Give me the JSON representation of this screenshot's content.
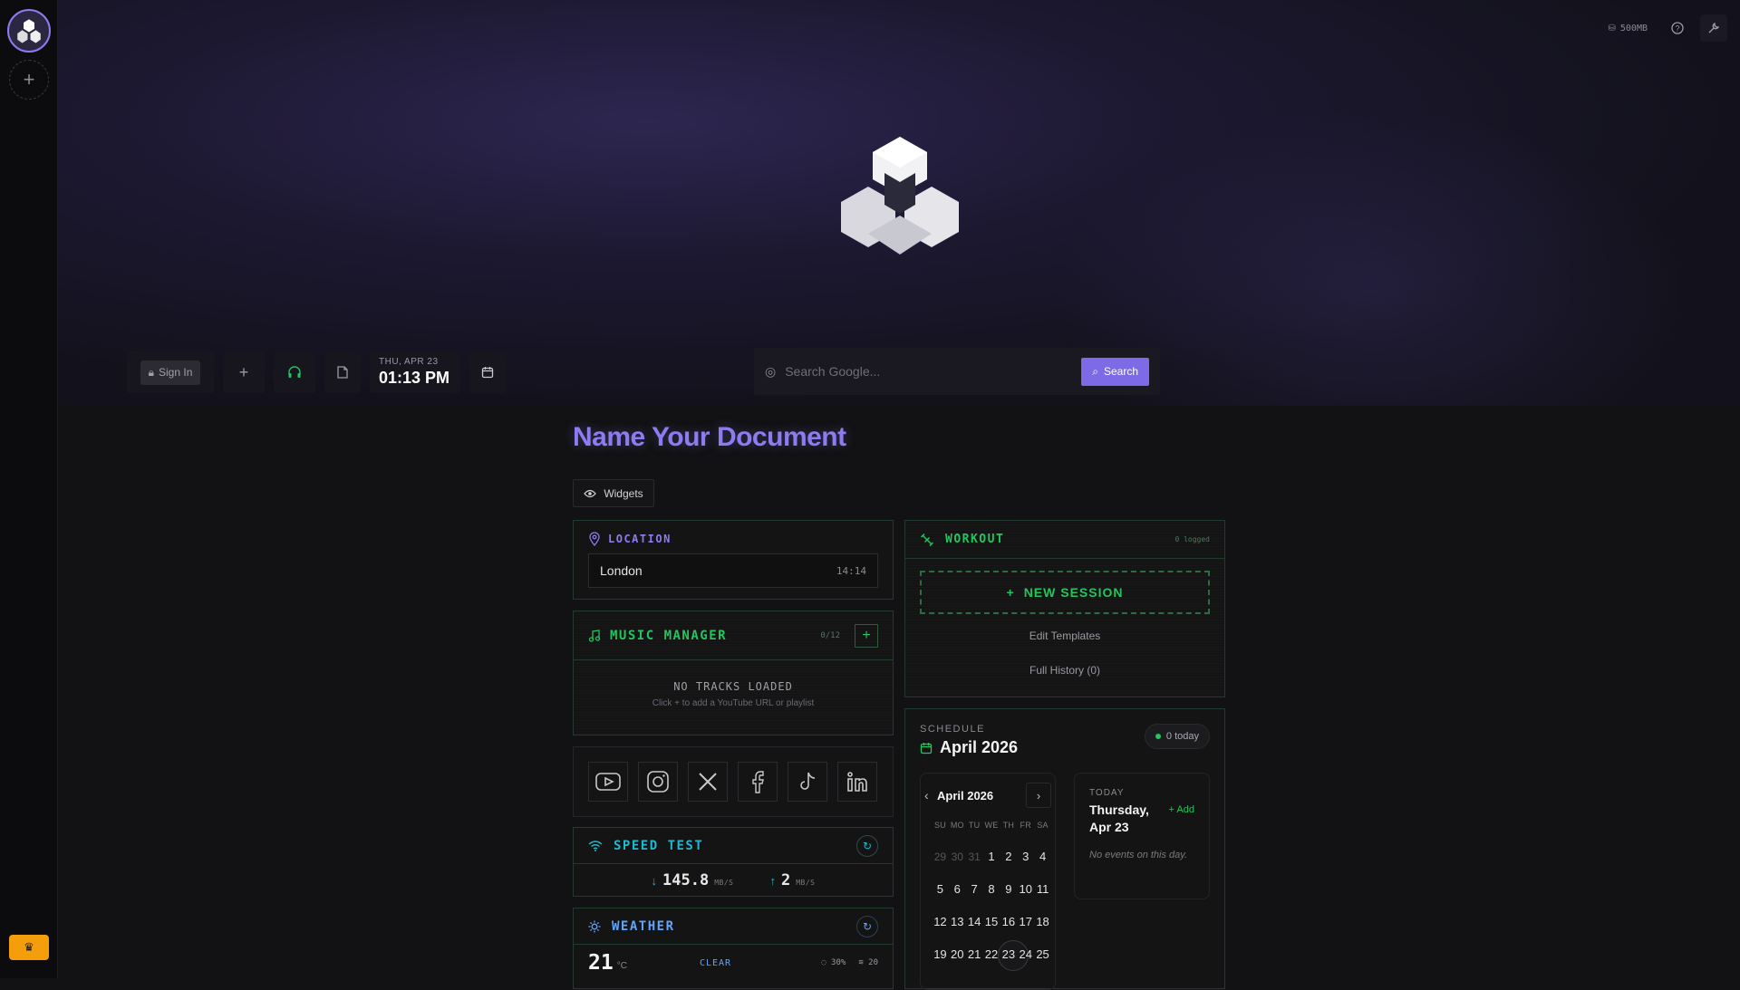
{
  "topbar": {
    "storage": "500MB",
    "help_icon": "help-icon",
    "settings_icon": "wrench-icon"
  },
  "toolbar": {
    "sign_in": "Sign In",
    "date": "THU, APR 23",
    "time": "01:13 PM"
  },
  "search": {
    "placeholder": "Search Google...",
    "button": "Search"
  },
  "document": {
    "title": "Name Your Document",
    "widgets_label": "Widgets"
  },
  "location": {
    "title": "LOCATION",
    "city": "London",
    "time": "14:14"
  },
  "music": {
    "title": "MUSIC MANAGER",
    "count": "0/12",
    "empty_title": "NO TRACKS LOADED",
    "empty_hint": "Click + to add a YouTube URL or playlist"
  },
  "social": [
    "youtube-icon",
    "instagram-icon",
    "x-icon",
    "facebook-icon",
    "tiktok-icon",
    "linkedin-icon"
  ],
  "speed": {
    "title": "SPEED TEST",
    "download": "145.8",
    "upload": "2",
    "unit": "MB/S"
  },
  "weather": {
    "title": "WEATHER",
    "temp": "21",
    "unit": "°C",
    "condition": "CLEAR",
    "humidity": "30%",
    "wind": "20"
  },
  "workout": {
    "title": "WORKOUT",
    "logged": "0 logged",
    "new_session": "NEW SESSION",
    "edit_templates": "Edit Templates",
    "history": "Full History (0)"
  },
  "schedule": {
    "label": "SCHEDULE",
    "month": "April 2026",
    "badge": "0 today",
    "calendar_month": "April 2026",
    "weekdays": [
      "SU",
      "MO",
      "TU",
      "WE",
      "TH",
      "FR",
      "SA"
    ],
    "days": [
      {
        "d": "29",
        "muted": true
      },
      {
        "d": "30",
        "muted": true
      },
      {
        "d": "31",
        "muted": true
      },
      {
        "d": "1"
      },
      {
        "d": "2"
      },
      {
        "d": "3"
      },
      {
        "d": "4"
      },
      {
        "d": "5"
      },
      {
        "d": "6"
      },
      {
        "d": "7"
      },
      {
        "d": "8"
      },
      {
        "d": "9"
      },
      {
        "d": "10"
      },
      {
        "d": "11"
      },
      {
        "d": "12"
      },
      {
        "d": "13"
      },
      {
        "d": "14"
      },
      {
        "d": "15"
      },
      {
        "d": "16"
      },
      {
        "d": "17"
      },
      {
        "d": "18"
      },
      {
        "d": "19"
      },
      {
        "d": "20"
      },
      {
        "d": "21"
      },
      {
        "d": "22"
      },
      {
        "d": "23",
        "today": true
      },
      {
        "d": "24"
      },
      {
        "d": "25"
      }
    ],
    "today_label": "TODAY",
    "today_date": "Thursday, Apr 23",
    "add_label": "Add",
    "no_events": "No events on this day."
  },
  "colors": {
    "accent": "#8b7cf0",
    "green": "#22c55e",
    "cyan": "#22b8cf",
    "blue": "#60a5fa"
  }
}
